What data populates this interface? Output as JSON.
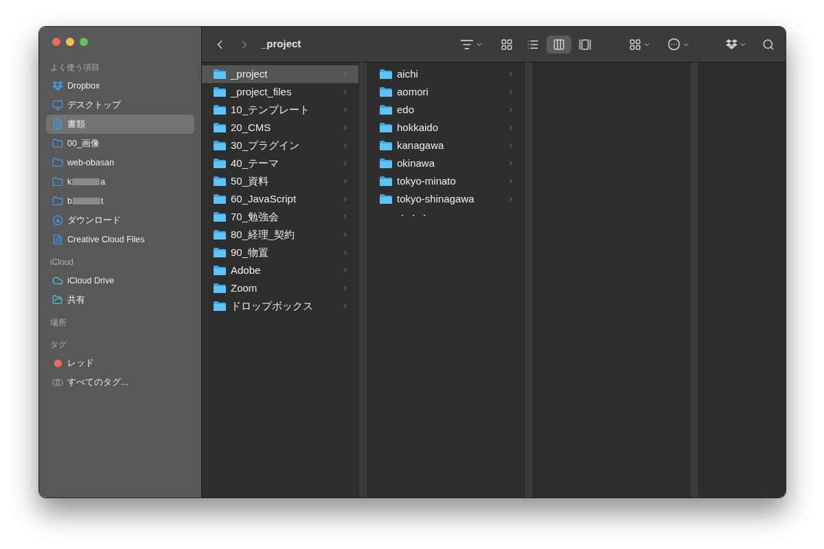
{
  "window": {
    "title": "_project"
  },
  "toolbar": {
    "views": [
      {
        "kind": "icons",
        "selected": false
      },
      {
        "kind": "list",
        "selected": false
      },
      {
        "kind": "columns",
        "selected": true
      },
      {
        "kind": "gallery",
        "selected": false
      }
    ]
  },
  "sidebar": {
    "sections": [
      {
        "title": "よく使う項目",
        "items": [
          {
            "kind": "dropbox",
            "label": "Dropbox",
            "selected": false
          },
          {
            "kind": "desktop",
            "label": "デスクトップ",
            "selected": false
          },
          {
            "kind": "document",
            "label": "書類",
            "selected": true
          },
          {
            "kind": "folder",
            "label": "00_画像",
            "selected": false
          },
          {
            "kind": "folder",
            "label": "web-obasan",
            "selected": false
          },
          {
            "kind": "folder",
            "label": "k",
            "label_end": "a",
            "redacted": true,
            "selected": false
          },
          {
            "kind": "folder",
            "label": "b",
            "label_end": "t",
            "redacted": true,
            "selected": false
          },
          {
            "kind": "download",
            "label": "ダウンロード",
            "selected": false
          },
          {
            "kind": "document",
            "label": "Creative Cloud Files",
            "selected": false
          }
        ]
      },
      {
        "title": "iCloud",
        "items": [
          {
            "kind": "cloud",
            "label": "iCloud Drive",
            "selected": false
          },
          {
            "kind": "shared",
            "label": "共有",
            "selected": false
          }
        ]
      },
      {
        "title": "場所"
      },
      {
        "title": "タグ",
        "items": [
          {
            "kind": "tag",
            "label": "レッド",
            "color": "#ec6a5e",
            "selected": false
          },
          {
            "kind": "all-tags",
            "label": "すべてのタグ...",
            "selected": false
          }
        ]
      }
    ]
  },
  "columns": [
    {
      "rows": [
        {
          "name": "_project",
          "selected": true
        },
        {
          "name": "_project_files",
          "selected": false
        },
        {
          "name": "10_テンプレート",
          "selected": false
        },
        {
          "name": "20_CMS",
          "selected": false
        },
        {
          "name": "30_プラグイン",
          "selected": false
        },
        {
          "name": "40_テーマ",
          "selected": false
        },
        {
          "name": "50_資料",
          "selected": false
        },
        {
          "name": "60_JavaScript",
          "selected": false
        },
        {
          "name": "70_勉強会",
          "selected": false
        },
        {
          "name": "80_経理_契約",
          "selected": false
        },
        {
          "name": "90_物置",
          "selected": false
        },
        {
          "name": "Adobe",
          "selected": false
        },
        {
          "name": "Zoom",
          "selected": false
        },
        {
          "name": "ドロップボックス",
          "selected": false
        }
      ]
    },
    {
      "rows": [
        {
          "name": "aichi",
          "selected": false
        },
        {
          "name": "aomori",
          "selected": false
        },
        {
          "name": "edo",
          "selected": false
        },
        {
          "name": "hokkaido",
          "selected": false
        },
        {
          "name": "kanagawa",
          "selected": false
        },
        {
          "name": "okinawa",
          "selected": false
        },
        {
          "name": "tokyo-minato",
          "selected": false
        },
        {
          "name": "tokyo-shinagawa",
          "selected": false
        }
      ],
      "more": "・・・"
    }
  ]
}
